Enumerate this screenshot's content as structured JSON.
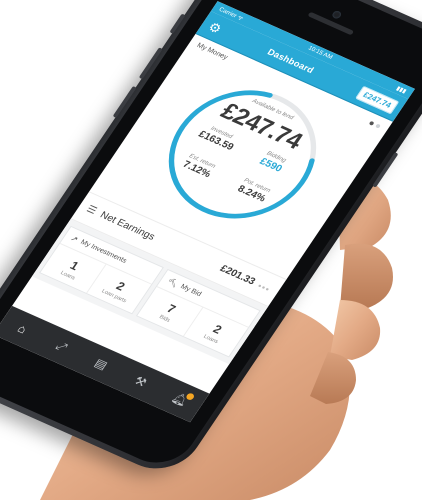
{
  "status_bar": {
    "carrier": "Carrier ᯤ",
    "time": "10:15 AM"
  },
  "header": {
    "title": "Dashboard",
    "balance_pill": "£247.74",
    "settings_icon": "gear-icon"
  },
  "my_money": {
    "label": "My Money",
    "pager_active_index": 0,
    "available_label": "Available to lend",
    "available_value": "£247.74",
    "gauge_fill_fraction": 0.78,
    "invested_label": "Invested",
    "invested_value": "£163.59",
    "bidding_label": "Bidding",
    "bidding_value": "£590",
    "est_return_label": "Est. return",
    "est_return_value": "7.12%",
    "pot_return_label": "Pot. return",
    "pot_return_value": "8.24%"
  },
  "net_earnings": {
    "label": "Net Earnings",
    "value": "£201.33",
    "more": "•••"
  },
  "cards": [
    {
      "title": "My Investments",
      "icon": "trend-up-icon",
      "cells": [
        {
          "num": "1",
          "sub": "Loans"
        },
        {
          "num": "2",
          "sub": "Loan parts"
        }
      ]
    },
    {
      "title": "My Bid",
      "icon": "gavel-icon",
      "cells": [
        {
          "num": "7",
          "sub": "Bids"
        },
        {
          "num": "2",
          "sub": "Loans"
        }
      ]
    }
  ],
  "tab_bar": {
    "items": [
      "home-icon",
      "market-icon",
      "portfolio-icon",
      "auction-icon",
      "bell-icon"
    ]
  },
  "colors": {
    "brand": "#29a9d6",
    "text": "#3a3a3a",
    "notification": "#f5a623",
    "phone_frame": "#2b2d31"
  }
}
